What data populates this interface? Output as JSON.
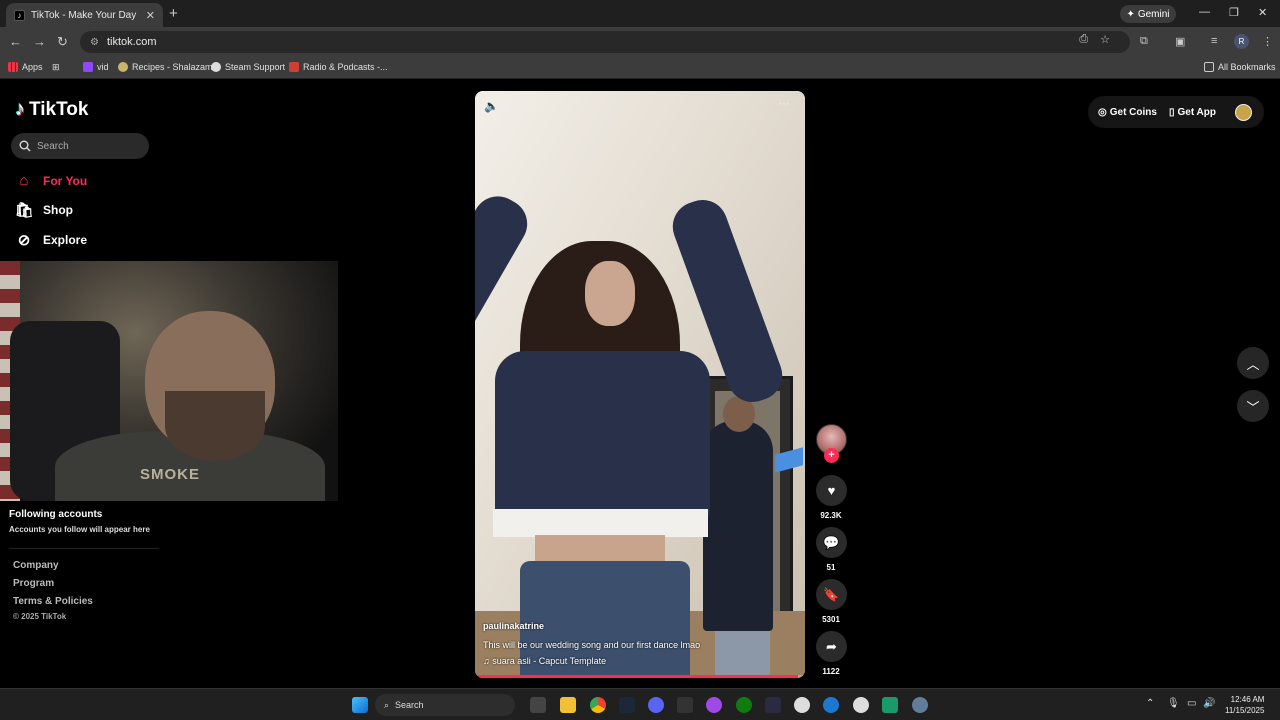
{
  "browser": {
    "tab_title": "TikTok - Make Your Day",
    "gemini_label": "Gemini",
    "url": "tiktok.com",
    "profile_initial": "R",
    "bookmarks": [
      "Apps",
      "vid",
      "Recipes - Shalazam",
      "Steam Support",
      "Radio & Podcasts -..."
    ],
    "all_bookmarks": "All Bookmarks"
  },
  "tiktok": {
    "brand": "TikTok",
    "search_placeholder": "Search",
    "nav": [
      {
        "label": "For You",
        "icon": "home-icon",
        "color": "#fe2c55"
      },
      {
        "label": "Shop",
        "icon": "shop-icon"
      },
      {
        "label": "Explore",
        "icon": "compass-icon"
      }
    ],
    "following_title": "Following accounts",
    "following_sub": "Accounts you follow will appear here",
    "footer_links": [
      "Company",
      "Program",
      "Terms & Policies"
    ],
    "copyright": "© 2025 TikTok",
    "webcam_shirt_text": "SMOKE",
    "top_right": {
      "get_coins": "Get Coins",
      "get_app": "Get App"
    },
    "video": {
      "username": "paulinakatrine",
      "description": "This will be our wedding song and our first dance lmao",
      "music": "suara asli - Capcut Template",
      "progress": 0.98
    },
    "actions": {
      "likes": "92.3K",
      "comments": "51",
      "saves": "5301",
      "shares": "1122"
    }
  },
  "taskbar": {
    "search_placeholder": "Search",
    "time": "12:46 AM",
    "date": "11/15/2025"
  },
  "colors": {
    "accent": "#fe2c55",
    "chrome_bg": "#3c3c3c"
  }
}
